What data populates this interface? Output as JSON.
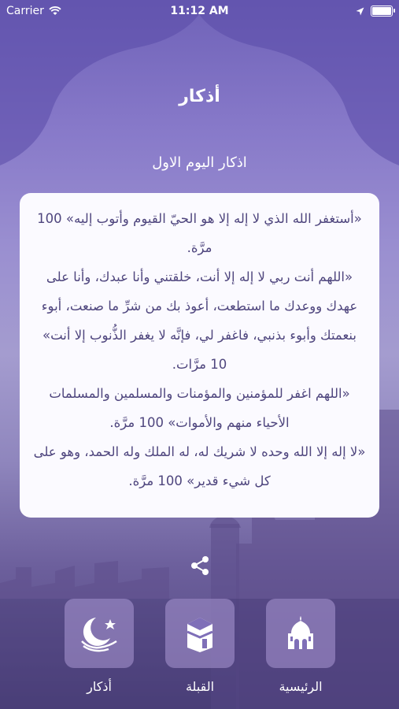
{
  "status_bar": {
    "carrier": "Carrier",
    "time": "11:12 AM"
  },
  "header": {
    "title": "أذكار"
  },
  "section": {
    "subtitle": "اذكار اليوم الاول"
  },
  "card": {
    "text": "«أستغفر الله الذي لا إله إلا هو الحيّ القيوم وأتوب إليه» 100 مرَّة.\n«اللهم أنت ربي لا إله إلا أنت، خلقتني وأنا عبدك، وأنا على عهدك ووعدك ما استطعت، أعوذ بك من شرِّ ما صنعت، أبوء بنعمتك وأبوء بذنبي، فاغفر لي، فإنَّه لا يغفر الذُّنوب إلا أنت» 10 مرَّات.\n«اللهم اغفر للمؤمنين والمؤمنات والمسلمين والمسلمات الأحياء منهم والأموات» 100 مرَّة.\n«لا إله إلا الله وحده لا شريك له، له الملك وله الحمد، وهو على كل شيء قدير» 100 مرَّة."
  },
  "icons": {
    "share": "share-icon",
    "azkar": "crescent-star-hand-icon",
    "qibla": "kaaba-icon",
    "home": "mosque-icon"
  },
  "tabs": {
    "azkar": "أذكار",
    "qibla": "القبلة",
    "home": "الرئيسية"
  },
  "colors": {
    "background_top": "#6f62b8",
    "background_bottom": "#4f447c",
    "card_text": "#4f467e",
    "card_background": "#fbfaff"
  }
}
